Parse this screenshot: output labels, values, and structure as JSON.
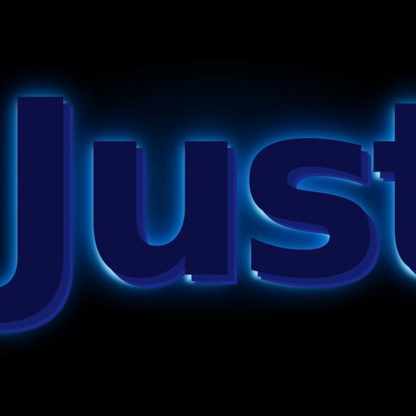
{
  "sign": {
    "text": "Just",
    "letter_color": "#0b0f45",
    "edge_color": "#1a2a8a",
    "glow_color": "#1ab8ff",
    "glow_core": "#bff0ff",
    "background": "#000000"
  }
}
